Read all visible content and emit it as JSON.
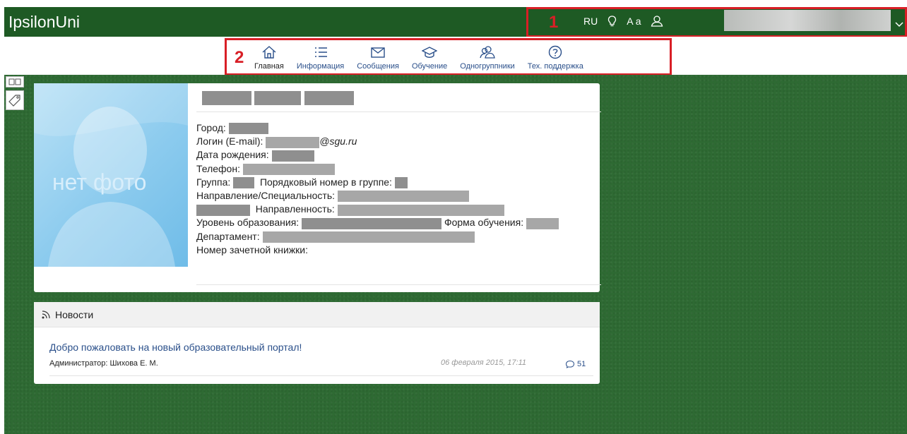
{
  "header": {
    "brand": "IpsilonUni",
    "annotation_1": "1",
    "language": "RU",
    "font_size_label": "A a",
    "background_color": "#1e5a24"
  },
  "nav": {
    "annotation_2": "2",
    "items": [
      {
        "label": "Главная",
        "icon": "home-icon"
      },
      {
        "label": "Информация",
        "icon": "list-icon"
      },
      {
        "label": "Сообщения",
        "icon": "envelope-icon"
      },
      {
        "label": "Обучение",
        "icon": "graduation-cap-icon"
      },
      {
        "label": "Одногруппники",
        "icon": "users-icon"
      },
      {
        "label": "Тех. поддержка",
        "icon": "question-icon"
      }
    ]
  },
  "profile": {
    "photo_placeholder": "нет фото",
    "city_label": "Город:",
    "login_label": "Логин (E-mail):",
    "login_domain": "@sgu.ru",
    "birthdate_label": "Дата рождения:",
    "phone_label": "Телефон:",
    "group_label": "Группа:",
    "group_number_label": "Порядковый номер в группе:",
    "direction_label": "Направление/Специальность:",
    "profile_label": "Направленность:",
    "education_level_label": "Уровень образования:",
    "study_form_label": "Форма обучения:",
    "department_label": "Департамент:",
    "record_book_label": "Номер зачетной книжки:"
  },
  "news": {
    "header": "Новости",
    "title": "Добро пожаловать на новый образовательный портал!",
    "author": "Администратор: Шихова Е. М.",
    "date": "06 февраля 2015, 17:11",
    "comments": "51"
  },
  "colors": {
    "accent_link": "#2a4f8a",
    "annotation_red": "#d81f26",
    "background_green": "#2e6a33"
  }
}
